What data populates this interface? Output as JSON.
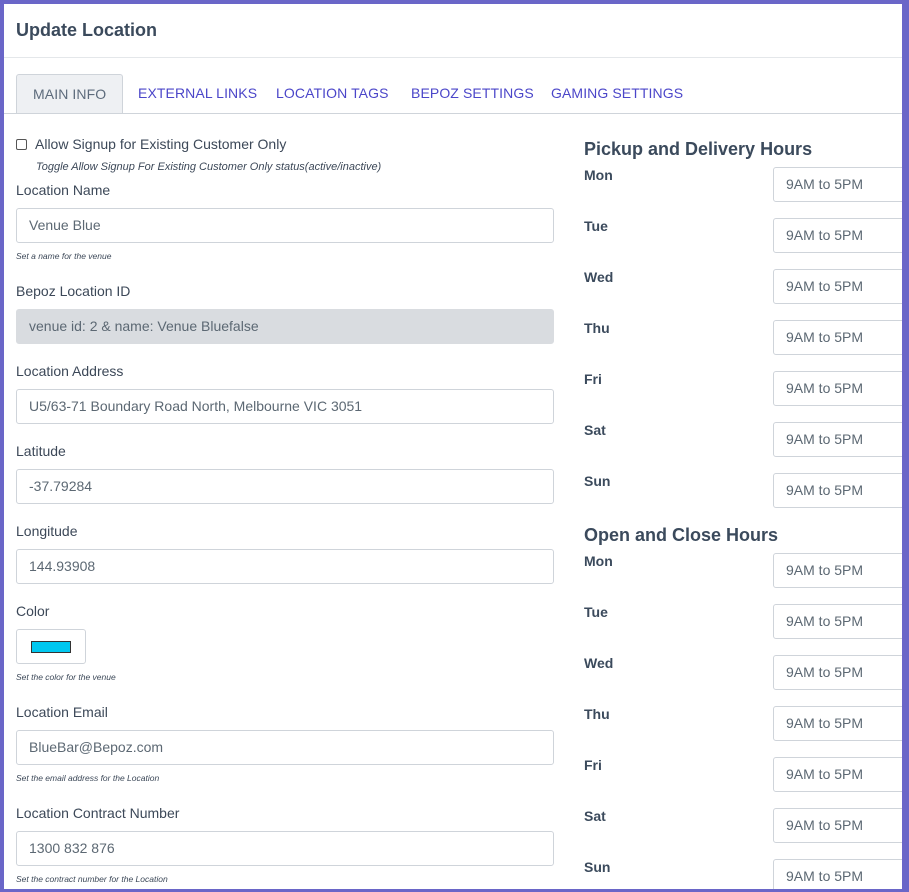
{
  "page": {
    "title": "Update Location"
  },
  "tabs": [
    {
      "label": "MAIN INFO",
      "active": true
    },
    {
      "label": "EXTERNAL LINKS",
      "active": false
    },
    {
      "label": "LOCATION TAGS",
      "active": false
    },
    {
      "label": "BEPOZ SETTINGS",
      "active": false
    },
    {
      "label": "GAMING SETTINGS",
      "active": false
    }
  ],
  "form": {
    "allow_signup": {
      "label": "Allow Signup for Existing Customer Only",
      "help": "Toggle Allow Signup For Existing Customer Only status(active/inactive)",
      "checked": false
    },
    "location_name": {
      "label": "Location Name",
      "value": "Venue Blue",
      "help": "Set a name for the venue"
    },
    "bepoz_location_id": {
      "label": "Bepoz Location ID",
      "value": "venue id: 2 & name: Venue Bluefalse"
    },
    "location_address": {
      "label": "Location Address",
      "value": "U5/63-71 Boundary Road North, Melbourne VIC 3051"
    },
    "latitude": {
      "label": "Latitude",
      "value": "-37.79284"
    },
    "longitude": {
      "label": "Longitude",
      "value": "144.93908"
    },
    "color": {
      "label": "Color",
      "value": "#00c8f0",
      "help": "Set the color for the venue"
    },
    "location_email": {
      "label": "Location Email",
      "value": "BlueBar@Bepoz.com",
      "help": "Set the email address for the Location"
    },
    "contract_number": {
      "label": "Location Contract Number",
      "value": "1300 832 876",
      "help": "Set the contract number for the Location"
    }
  },
  "pickup_delivery": {
    "title": "Pickup and Delivery Hours",
    "days": [
      {
        "day": "Mon",
        "hours": "9AM to 5PM"
      },
      {
        "day": "Tue",
        "hours": "9AM to 5PM"
      },
      {
        "day": "Wed",
        "hours": "9AM to 5PM"
      },
      {
        "day": "Thu",
        "hours": "9AM to 5PM"
      },
      {
        "day": "Fri",
        "hours": "9AM to 5PM"
      },
      {
        "day": "Sat",
        "hours": "9AM to 5PM"
      },
      {
        "day": "Sun",
        "hours": "9AM to 5PM"
      }
    ]
  },
  "open_close": {
    "title": "Open and Close Hours",
    "days": [
      {
        "day": "Mon",
        "hours": "9AM to 5PM"
      },
      {
        "day": "Tue",
        "hours": "9AM to 5PM"
      },
      {
        "day": "Wed",
        "hours": "9AM to 5PM"
      },
      {
        "day": "Thu",
        "hours": "9AM to 5PM"
      },
      {
        "day": "Fri",
        "hours": "9AM to 5PM"
      },
      {
        "day": "Sat",
        "hours": "9AM to 5PM"
      },
      {
        "day": "Sun",
        "hours": "9AM to 5PM"
      }
    ]
  },
  "colors": {
    "accent": "#4b46c9",
    "frame": "#6a66c8"
  }
}
